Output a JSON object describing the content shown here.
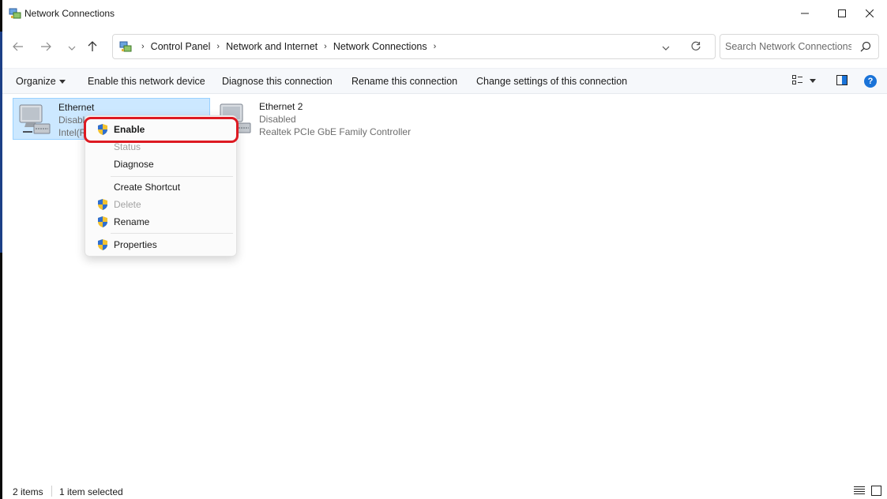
{
  "window": {
    "title": "Network Connections",
    "controls": [
      "minimize-icon",
      "maximize-icon",
      "close-icon"
    ]
  },
  "navigation": {
    "breadcrumb": [
      "Control Panel",
      "Network and Internet",
      "Network Connections"
    ],
    "search_placeholder": "Search Network Connections",
    "icons": [
      "back-arrow-icon",
      "forward-arrow-icon",
      "chevron-down-icon",
      "up-arrow-icon",
      "refresh-icon",
      "search-icon"
    ]
  },
  "commands": {
    "organize": "Organize",
    "enable": "Enable this network device",
    "diagnose": "Diagnose this connection",
    "rename": "Rename this connection",
    "change": "Change settings of this connection",
    "help": "?"
  },
  "items": [
    {
      "name": "Ethernet",
      "status": "Disabled",
      "device": "Intel(R)",
      "selected": true
    },
    {
      "name": "Ethernet 2",
      "status": "Disabled",
      "device": "Realtek PCIe GbE Family Controller",
      "selected": false
    }
  ],
  "context_menu": {
    "items": [
      {
        "label": "Enable",
        "shield": true,
        "enabled": true,
        "bold": true,
        "highlighted": true
      },
      {
        "label": "Status",
        "shield": false,
        "enabled": false
      },
      {
        "label": "Diagnose",
        "shield": false,
        "enabled": true
      },
      {
        "label": "Create Shortcut",
        "shield": false,
        "enabled": true
      },
      {
        "label": "Delete",
        "shield": true,
        "enabled": false
      },
      {
        "label": "Rename",
        "shield": true,
        "enabled": true
      },
      {
        "label": "Properties",
        "shield": true,
        "enabled": true
      }
    ]
  },
  "statusbar": {
    "count": "2 items",
    "selected": "1 item selected"
  },
  "colors": {
    "selection_bg": "#cce8ff",
    "highlight_outline": "#dd1a22",
    "help_blue": "#1a73d8"
  }
}
